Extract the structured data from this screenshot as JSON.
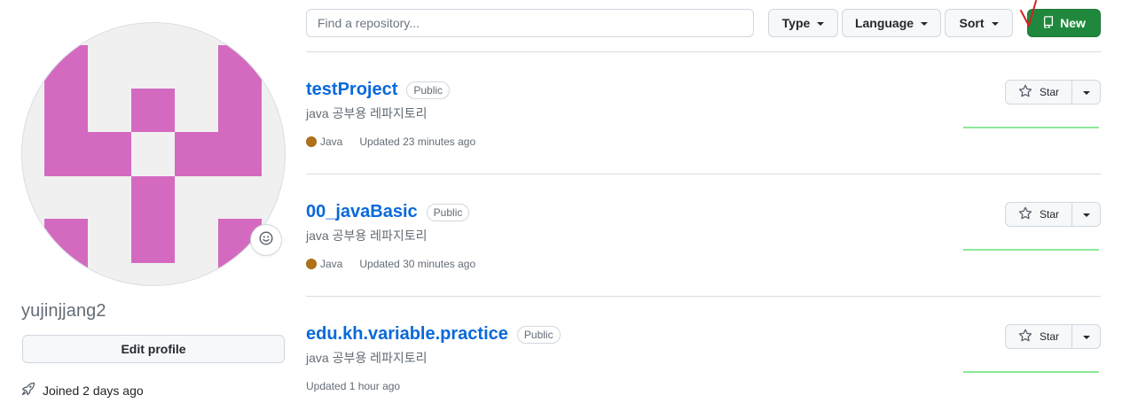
{
  "profile": {
    "username": "yujinjjang2",
    "edit_profile_label": "Edit profile",
    "joined_text": "Joined 2 days ago",
    "avatar_color": "#d46ac0"
  },
  "filters": {
    "search_placeholder": "Find a repository...",
    "type_label": "Type",
    "language_label": "Language",
    "sort_label": "Sort",
    "new_label": "New"
  },
  "repos": [
    {
      "name": "testProject",
      "visibility": "Public",
      "description": "java 공부용 레파지토리",
      "language": "Java",
      "updated": "Updated 23 minutes ago",
      "star_label": "Star"
    },
    {
      "name": "00_javaBasic",
      "visibility": "Public",
      "description": "java 공부용 레파지토리",
      "language": "Java",
      "updated": "Updated 30 minutes ago",
      "star_label": "Star"
    },
    {
      "name": "edu.kh.variable.practice",
      "visibility": "Public",
      "description": "java 공부용 레파지토리",
      "language": "",
      "updated": "Updated 1 hour ago",
      "star_label": "Star"
    }
  ],
  "colors": {
    "link": "#0969da",
    "java": "#b07219",
    "new_button": "#1f883d",
    "activity_line": "#8ce99a"
  }
}
